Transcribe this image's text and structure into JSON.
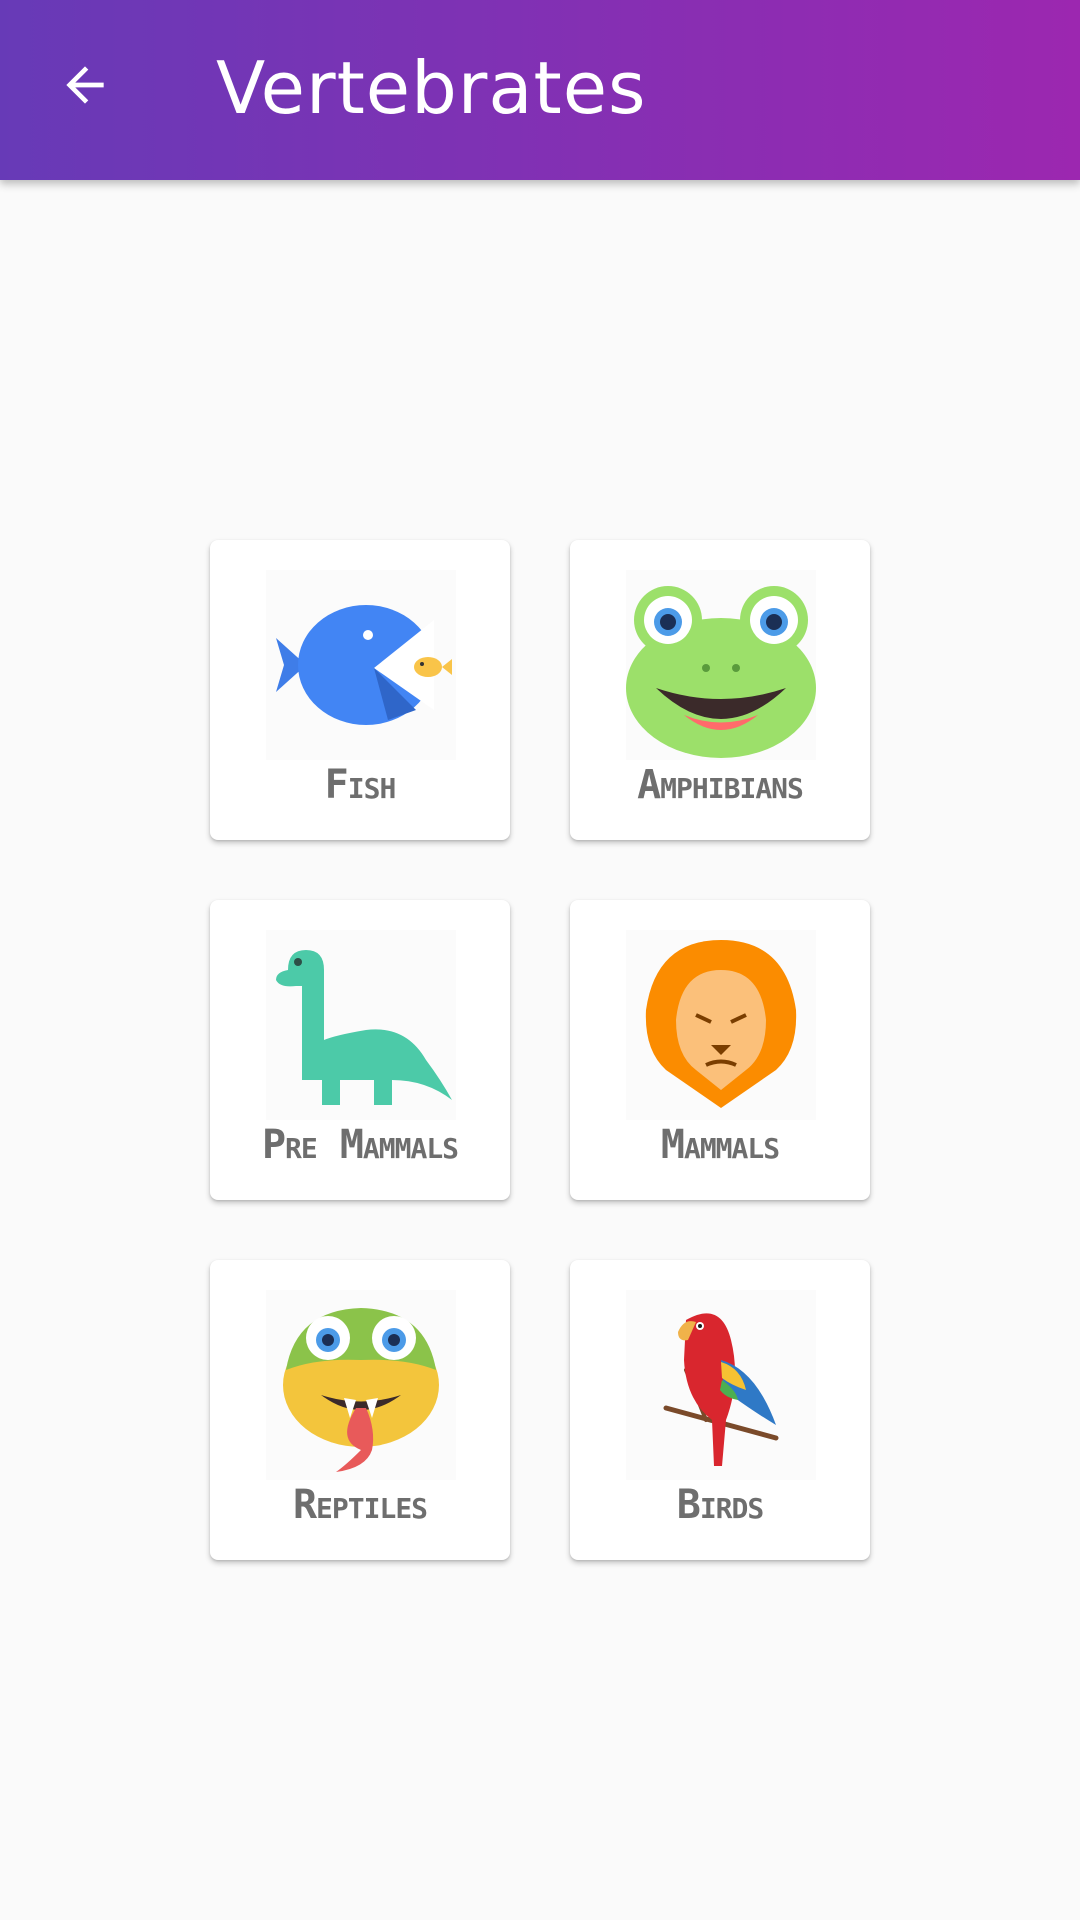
{
  "app_bar": {
    "title": "Vertebrates",
    "back_icon": "arrow-left-icon",
    "gradient": [
      "#673ab7",
      "#9c27b0"
    ]
  },
  "categories": [
    {
      "label": "Fish",
      "icon": "fish-icon"
    },
    {
      "label": "Amphibians",
      "icon": "frog-icon"
    },
    {
      "label": "Pre Mammals",
      "icon": "dinosaur-icon"
    },
    {
      "label": "Mammals",
      "icon": "lion-icon"
    },
    {
      "label": "Reptiles",
      "icon": "snake-icon"
    },
    {
      "label": "Birds",
      "icon": "parrot-icon"
    }
  ]
}
